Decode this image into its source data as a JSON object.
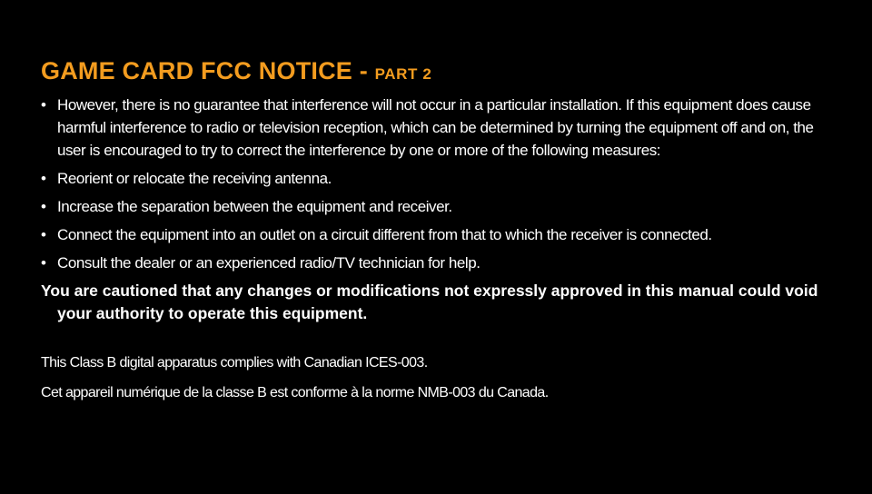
{
  "header": {
    "title_main": "GAME CARD FCC NOTICE - ",
    "title_sub": "PART 2"
  },
  "bullet_glyph": "•",
  "bullets": [
    "However, there is no guarantee that interference will not occur in a particular installation. If this equipment does cause harmful interference to radio or television reception, which can be determined by turning the equipment off and on, the user is encouraged to try to correct the interference by one or more of the following measures:",
    "Reorient or relocate the receiving antenna.",
    "Increase the separation between the equipment and receiver.",
    "Connect the equipment into an outlet on a circuit different from that to which the receiver is connected.",
    "Consult the dealer or an experienced radio/TV technician for help."
  ],
  "caution": "You are cautioned that any changes or modifications not expressly approved in this manual could void your authority to operate this equipment.",
  "notices": {
    "english": "This Class B digital apparatus complies with Canadian ICES-003.",
    "french": "Cet appareil numérique de la classe B est conforme à la norme NMB-003 du Canada."
  },
  "colors": {
    "background": "#000000",
    "title": "#f39c1f",
    "text": "#ffffff"
  }
}
